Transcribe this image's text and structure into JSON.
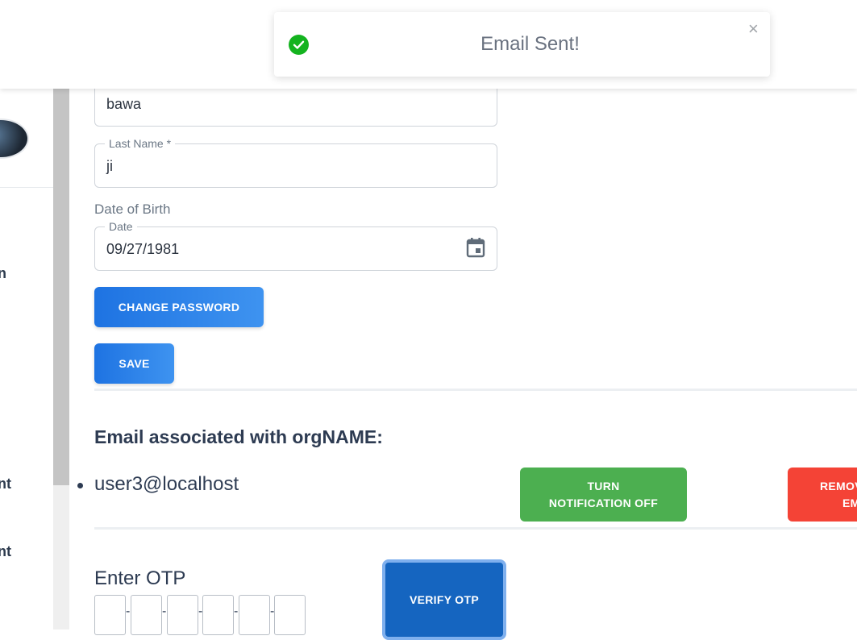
{
  "toast": {
    "message": "Email Sent!",
    "close": "×"
  },
  "sidebar": {
    "fragments": [
      "n",
      "nt",
      "nt"
    ]
  },
  "profile": {
    "first_name_value": "bawa",
    "last_name": {
      "label": "Last Name",
      "required_mark": "*",
      "value": "ji"
    },
    "dob": {
      "section_label": "Date of Birth",
      "field_label": "Date",
      "value": "09/27/1981"
    },
    "change_password_label": "CHANGE PASSWORD",
    "save_label": "SAVE"
  },
  "email_section": {
    "heading": "Email associated with orgNAME:",
    "address": "user3@localhost",
    "turn_off_label_line1": "TURN",
    "turn_off_label_line2": "NOTIFICATION OFF",
    "remove_label_line1": "REMOV",
    "remove_label_line2": "EM"
  },
  "otp": {
    "label": "Enter OTP",
    "verify_label": "VERIFY OTP",
    "dash": "-"
  },
  "colors": {
    "accent_blue": "#1e73e2",
    "success_green": "#4caf50",
    "danger_red": "#f44336",
    "verify_blue": "#1565c0",
    "toast_check": "#14b31f"
  },
  "icons": {
    "toast": "check-circle-icon",
    "date": "calendar-icon",
    "close": "close-icon"
  }
}
